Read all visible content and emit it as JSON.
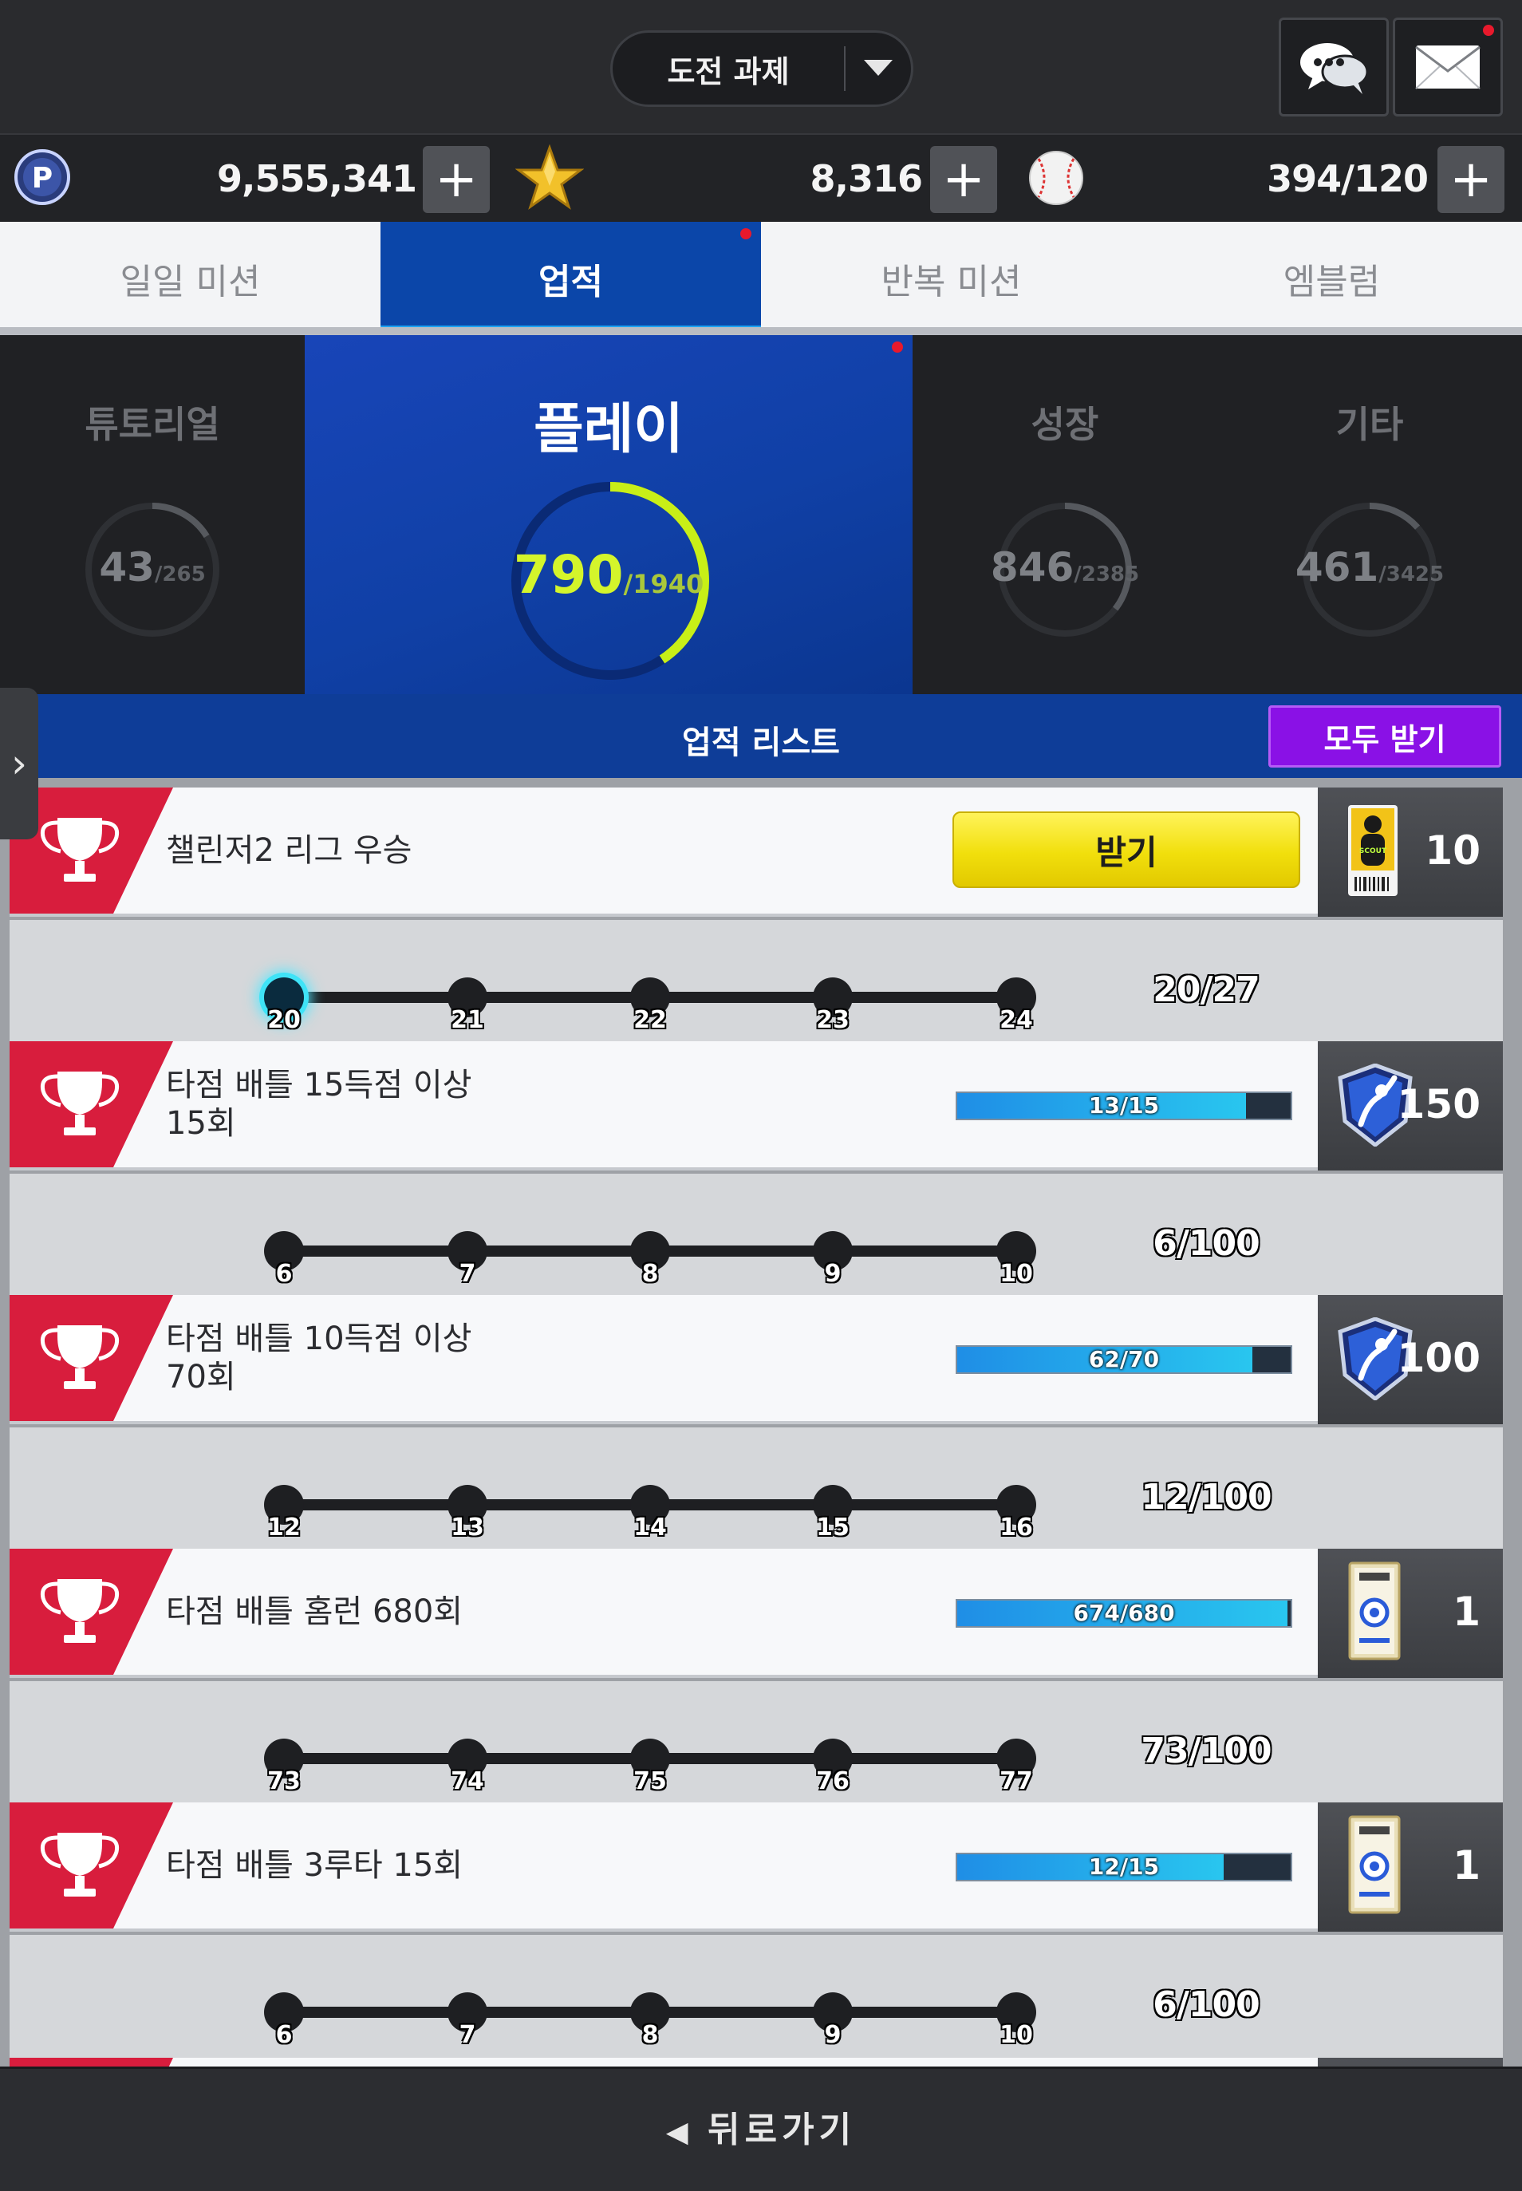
{
  "header": {
    "title": "도전 과제"
  },
  "currency": {
    "points": "9,555,341",
    "stars": "8,316",
    "balls": "394/120"
  },
  "tabs": [
    {
      "label": "일일 미션"
    },
    {
      "label": "업적"
    },
    {
      "label": "반복 미션"
    },
    {
      "label": "엠블럼"
    }
  ],
  "categories": [
    {
      "name": "튜토리얼",
      "value": "43",
      "total": "/265",
      "progress": 0.162
    },
    {
      "name": "플레이",
      "value": "790",
      "total": "/1940",
      "progress": 0.407
    },
    {
      "name": "성장",
      "value": "846",
      "total": "/2385",
      "progress": 0.355
    },
    {
      "name": "기타",
      "value": "461",
      "total": "/3425",
      "progress": 0.135
    }
  ],
  "list_header": {
    "title": "업적 리스트",
    "receive_all": "모두 받기"
  },
  "achievements": [
    {
      "name": "챌린저2 리그 우승",
      "claim_label": "받기",
      "reward_qty": "10",
      "reward_icon": "scout-ticket-icon",
      "steps": [
        "20",
        "21",
        "22",
        "23",
        "24"
      ],
      "step_count": "20/27"
    },
    {
      "name": "타점 배틀 15득점 이상\n15회",
      "progress_text": "13/15",
      "progress": 0.867,
      "reward_qty": "150",
      "reward_icon": "batter-emblem-icon",
      "steps": [
        "6",
        "7",
        "8",
        "9",
        "10"
      ],
      "step_count": "6/100"
    },
    {
      "name": "타점 배틀 10득점 이상\n70회",
      "progress_text": "62/70",
      "progress": 0.886,
      "reward_qty": "100",
      "reward_icon": "batter-emblem-icon",
      "steps": [
        "12",
        "13",
        "14",
        "15",
        "16"
      ],
      "step_count": "12/100"
    },
    {
      "name": "타점 배틀 홈런 680회",
      "progress_text": "674/680",
      "progress": 0.991,
      "reward_qty": "1",
      "reward_icon": "player-pack-icon",
      "steps": [
        "73",
        "74",
        "75",
        "76",
        "77"
      ],
      "step_count": "73/100"
    },
    {
      "name": "타점 배틀 3루타 15회",
      "progress_text": "12/15",
      "progress": 0.8,
      "reward_qty": "1",
      "reward_icon": "player-pack-icon",
      "steps": [
        "6",
        "7",
        "8",
        "9",
        "10"
      ],
      "step_count": "6/100"
    }
  ],
  "footer": {
    "back_label": "뒤로가기"
  },
  "colors": {
    "accent_blue": "#0b46a9",
    "claim_yellow": "#f1df0c",
    "receive_purple": "#8a11e6",
    "ring_green": "#c8ef17"
  }
}
